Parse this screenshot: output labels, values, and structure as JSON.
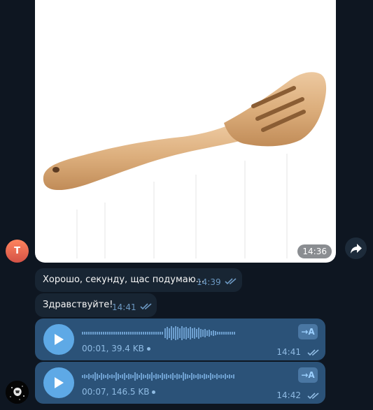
{
  "messages": {
    "photo": {
      "time": "14:36"
    },
    "sender_initial": "T",
    "text_1": {
      "text": "Хорошо, секунду, щас подумаю...",
      "time": "14:39"
    },
    "text_2": {
      "text": "Здравствуйте!",
      "time": "14:41"
    },
    "voice_1": {
      "info": "00:01, 39.4 KB",
      "time": "14:41",
      "transcribe_label": "→A"
    },
    "voice_2": {
      "info": "00:07, 146.5 KB",
      "time": "14:42",
      "transcribe_label": "→A"
    }
  },
  "colors": {
    "background": "#0e1621",
    "incoming_bubble": "#182533",
    "outgoing_bubble": "#2b5278",
    "accent": "#5ea9e6",
    "check_color": "#6c98c2"
  },
  "icons": [
    "forward-icon",
    "play-icon",
    "double-check-icon",
    "transcribe-icon"
  ]
}
